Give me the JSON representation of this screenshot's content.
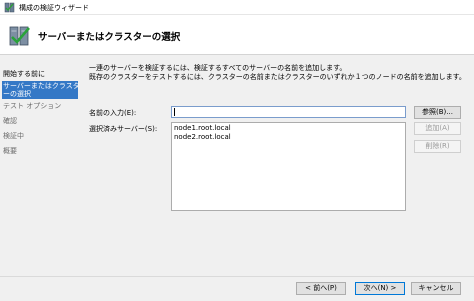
{
  "window": {
    "title": "構成の検証ウィザード"
  },
  "header": {
    "title": "サーバーまたはクラスターの選択"
  },
  "nav": {
    "items": [
      {
        "label": "開始する前に"
      },
      {
        "label_line1": "サーバーまたはクラスタ",
        "label_line2": "ーの選択"
      },
      {
        "label": "テスト オプション"
      },
      {
        "label": "確認"
      },
      {
        "label": "検証中"
      },
      {
        "label": "概要"
      }
    ]
  },
  "main": {
    "description_line1": "一連のサーバーを検証するには、検証するすべてのサーバーの名前を追加します。",
    "description_line2": "既存のクラスターをテストするには、クラスターの名前またはクラスターのいずれか１つのノードの名前を追加します。",
    "name_label": "名前の入力(E):",
    "name_value": "",
    "selected_label": "選択済みサーバー(S):",
    "servers": [
      "node1.root.local",
      "node2.root.local"
    ],
    "browse_label": "参照(B)...",
    "add_label": "追加(A)",
    "remove_label": "削除(R)"
  },
  "footer": {
    "back_label": "< 前へ(P)",
    "next_label": "次へ(N) >",
    "cancel_label": "キャンセル"
  }
}
